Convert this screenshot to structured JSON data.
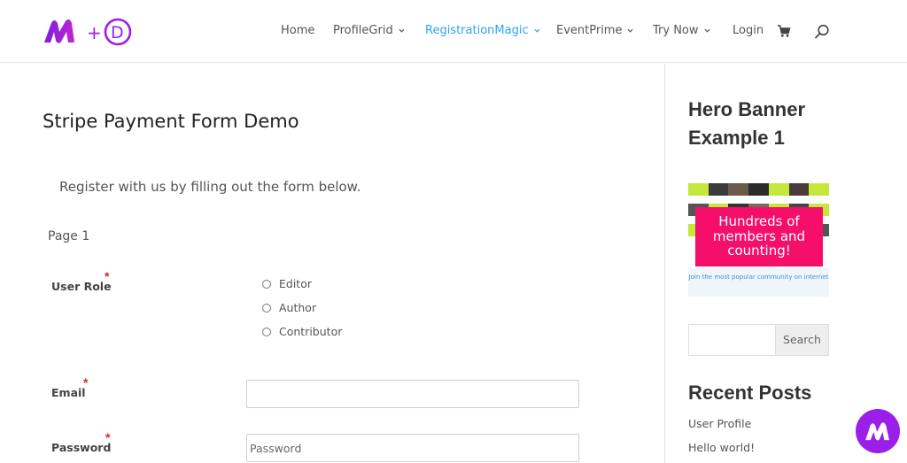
{
  "nav": {
    "items": [
      {
        "label": "Home",
        "has_dropdown": false,
        "active": false
      },
      {
        "label": "ProfileGrid",
        "has_dropdown": true,
        "active": false
      },
      {
        "label": "RegistrationMagic",
        "has_dropdown": true,
        "active": true
      },
      {
        "label": "EventPrime",
        "has_dropdown": true,
        "active": false
      },
      {
        "label": "Try Now",
        "has_dropdown": true,
        "active": false
      },
      {
        "label": "Login",
        "has_dropdown": false,
        "active": false
      }
    ],
    "icons": {
      "cart": "cart-icon",
      "search": "search-icon"
    }
  },
  "logo": {
    "plus": "+",
    "letter": "D"
  },
  "main": {
    "title": "Stripe Payment Form Demo",
    "intro": "Register with us by filling out the form below.",
    "page_label": "Page 1",
    "fields": {
      "user_role": {
        "label": "User Role",
        "required_mark": "*",
        "options": [
          "Editor",
          "Author",
          "Contributor"
        ]
      },
      "email": {
        "label": "Email",
        "required_mark": "*",
        "value": "",
        "placeholder": ""
      },
      "password": {
        "label": "Password",
        "required_mark": "*",
        "value": "",
        "placeholder": "Password"
      }
    }
  },
  "sidebar": {
    "hero_title": "Hero Banner Example 1",
    "banner": {
      "headline": "Hundreds of members and counting!",
      "tagline": "Join the most popular community on internet"
    },
    "search": {
      "button_label": "Search",
      "value": ""
    },
    "recent_posts": {
      "title": "Recent Posts",
      "items": [
        "User Profile",
        "Hello world!"
      ]
    }
  },
  "colors": {
    "accent": "#2ea3f2",
    "brand_purple": "#9b1fe8",
    "banner_pink": "#f50f6b",
    "required": "#e02424"
  }
}
